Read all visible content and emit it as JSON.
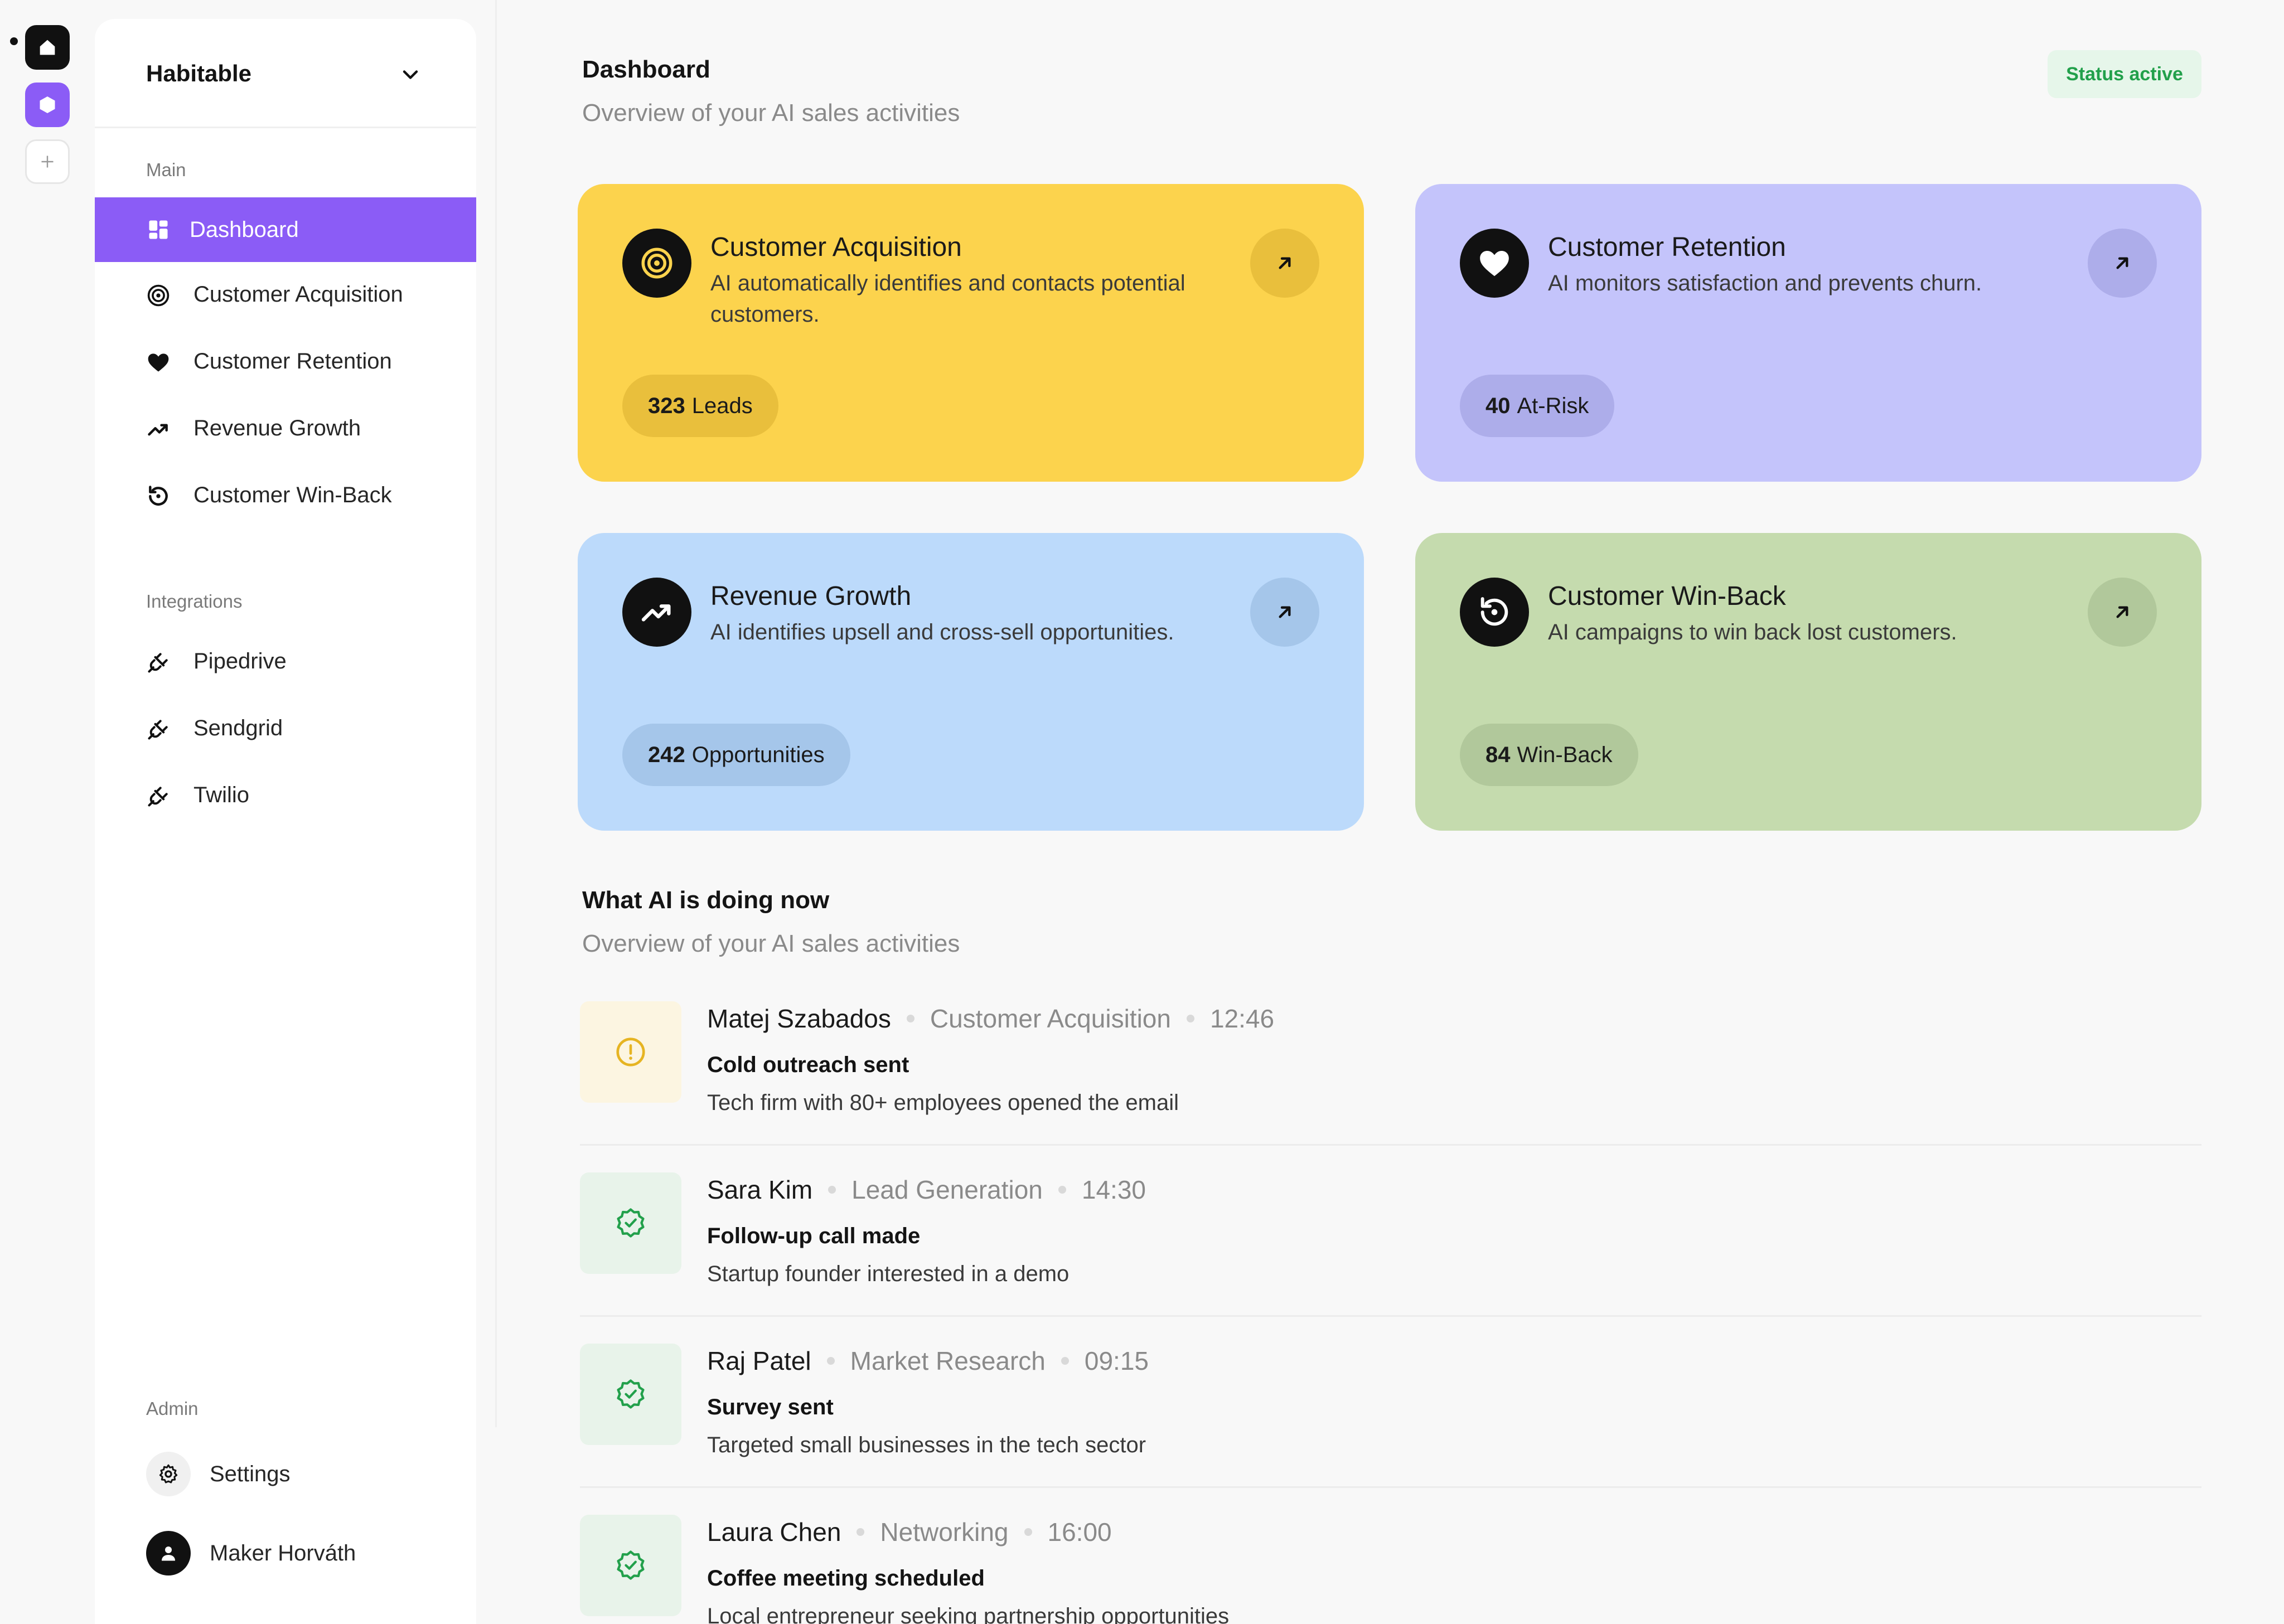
{
  "workspace": {
    "name": "Habitable"
  },
  "sidebar": {
    "main_label": "Main",
    "main_items": [
      {
        "label": "Dashboard",
        "icon": "grid-icon",
        "active": true
      },
      {
        "label": "Customer Acquisition",
        "icon": "target-icon"
      },
      {
        "label": "Customer Retention",
        "icon": "heart-icon"
      },
      {
        "label": "Revenue Growth",
        "icon": "trending-up-icon"
      },
      {
        "label": "Customer Win-Back",
        "icon": "history-icon"
      }
    ],
    "integrations_label": "Integrations",
    "integration_items": [
      {
        "label": "Pipedrive",
        "icon": "plug-icon"
      },
      {
        "label": "Sendgrid",
        "icon": "plug-icon"
      },
      {
        "label": "Twilio",
        "icon": "plug-icon"
      }
    ],
    "admin_label": "Admin",
    "settings_label": "Settings",
    "user_name": "Maker Horváth"
  },
  "header": {
    "title": "Dashboard",
    "subtitle": "Overview of your AI sales activities",
    "status": "Status active"
  },
  "cards": [
    {
      "title": "Customer Acquisition",
      "desc": "AI automatically identifies and contacts potential customers.",
      "count": "323",
      "unit": "Leads",
      "icon": "target-icon",
      "color": "#fcd34d"
    },
    {
      "title": "Customer Retention",
      "desc": "AI monitors satisfaction and prevents churn.",
      "count": "40",
      "unit": "At-Risk",
      "icon": "heart-icon",
      "color": "#c4c4fb"
    },
    {
      "title": "Revenue Growth",
      "desc": "AI identifies upsell and cross-sell opportunities.",
      "count": "242",
      "unit": "Opportunities",
      "icon": "trending-up-icon",
      "color": "#bcdafb"
    },
    {
      "title": "Customer Win-Back",
      "desc": "AI campaigns to win back lost customers.",
      "count": "84",
      "unit": "Win-Back",
      "icon": "history-icon",
      "color": "#c5dbae"
    }
  ],
  "activity": {
    "title": "What AI is doing now",
    "subtitle": "Overview of your AI sales activities",
    "items": [
      {
        "name": "Matej Szabados",
        "category": "Customer Acquisition",
        "time": "12:46",
        "title": "Cold outreach sent",
        "desc": "Tech firm with 80+ employees opened the email",
        "icon": "alert-circle-icon"
      },
      {
        "name": "Sara Kim",
        "category": "Lead Generation",
        "time": "14:30",
        "title": "Follow-up call made",
        "desc": "Startup founder interested in a demo",
        "icon": "badge-check-icon"
      },
      {
        "name": "Raj Patel",
        "category": "Market Research",
        "time": "09:15",
        "title": "Survey sent",
        "desc": "Targeted small businesses in the tech sector",
        "icon": "badge-check-icon"
      },
      {
        "name": "Laura Chen",
        "category": "Networking",
        "time": "16:00",
        "title": "Coffee meeting scheduled",
        "desc": "Local entrepreneur seeking partnership opportunities",
        "icon": "badge-check-icon"
      }
    ]
  }
}
